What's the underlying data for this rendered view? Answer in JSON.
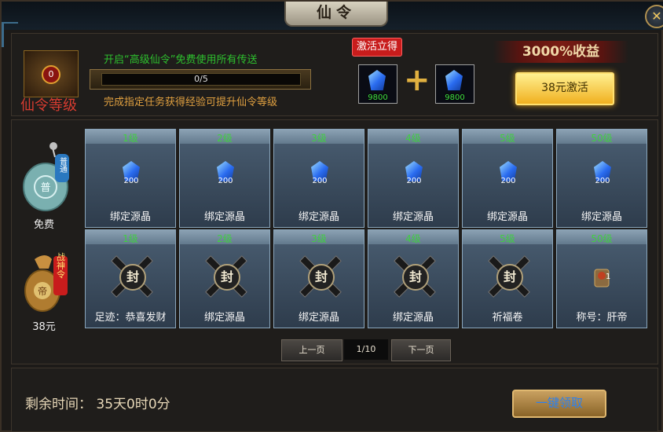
{
  "window": {
    "title": "仙令",
    "close_symbol": "✕"
  },
  "header": {
    "tier_badge_value": "0",
    "tier_badge_label": "仙令等级",
    "promo_text": "开启“高级仙令”免费使用所有传送",
    "progress_text": "0/5",
    "progress_fraction": 0,
    "hint_text": "完成指定任务获得经验可提升仙令等级",
    "activate_tag": "激活立得",
    "reward_slots": [
      {
        "icon": "blue-crystal",
        "amount": "9800"
      },
      {
        "icon": "blue-crystal",
        "amount": "9800"
      }
    ],
    "plus": "+",
    "earnings_banner": "3000%收益",
    "activate_button": "38元激活"
  },
  "tiers": [
    {
      "name": "free",
      "label": "免费",
      "icon_text": "普通",
      "icon_char": "普"
    },
    {
      "name": "paid",
      "label": "38元",
      "icon_text": "战神令",
      "icon_char": "帝"
    }
  ],
  "free_rewards": [
    {
      "level": "1级",
      "amount": "200",
      "name": "绑定源晶"
    },
    {
      "level": "2级",
      "amount": "200",
      "name": "绑定源晶"
    },
    {
      "level": "3级",
      "amount": "200",
      "name": "绑定源晶"
    },
    {
      "level": "4级",
      "amount": "200",
      "name": "绑定源晶"
    },
    {
      "level": "5级",
      "amount": "200",
      "name": "绑定源晶"
    },
    {
      "level": "50级",
      "amount": "200",
      "name": "绑定源晶"
    }
  ],
  "paid_rewards": [
    {
      "level": "1级",
      "seal": "封",
      "name": "足迹：恭喜发财"
    },
    {
      "level": "2级",
      "seal": "封",
      "name": "绑定源晶"
    },
    {
      "level": "3级",
      "seal": "封",
      "name": "绑定源晶"
    },
    {
      "level": "4级",
      "seal": "封",
      "name": "绑定源晶"
    },
    {
      "level": "5级",
      "seal": "封",
      "name": "祈福卷"
    },
    {
      "level": "50级",
      "amount": "1",
      "name": "称号：肝帝"
    }
  ],
  "pager": {
    "prev": "上一页",
    "page": "1/10",
    "next": "下一页"
  },
  "footer": {
    "time_label": "剩余时间：",
    "time_value": "35天0时0分",
    "claim_button": "一键领取"
  },
  "colors": {
    "accent_green": "#2ec02e",
    "gold": "#f0b020",
    "red": "#c81c1c"
  }
}
